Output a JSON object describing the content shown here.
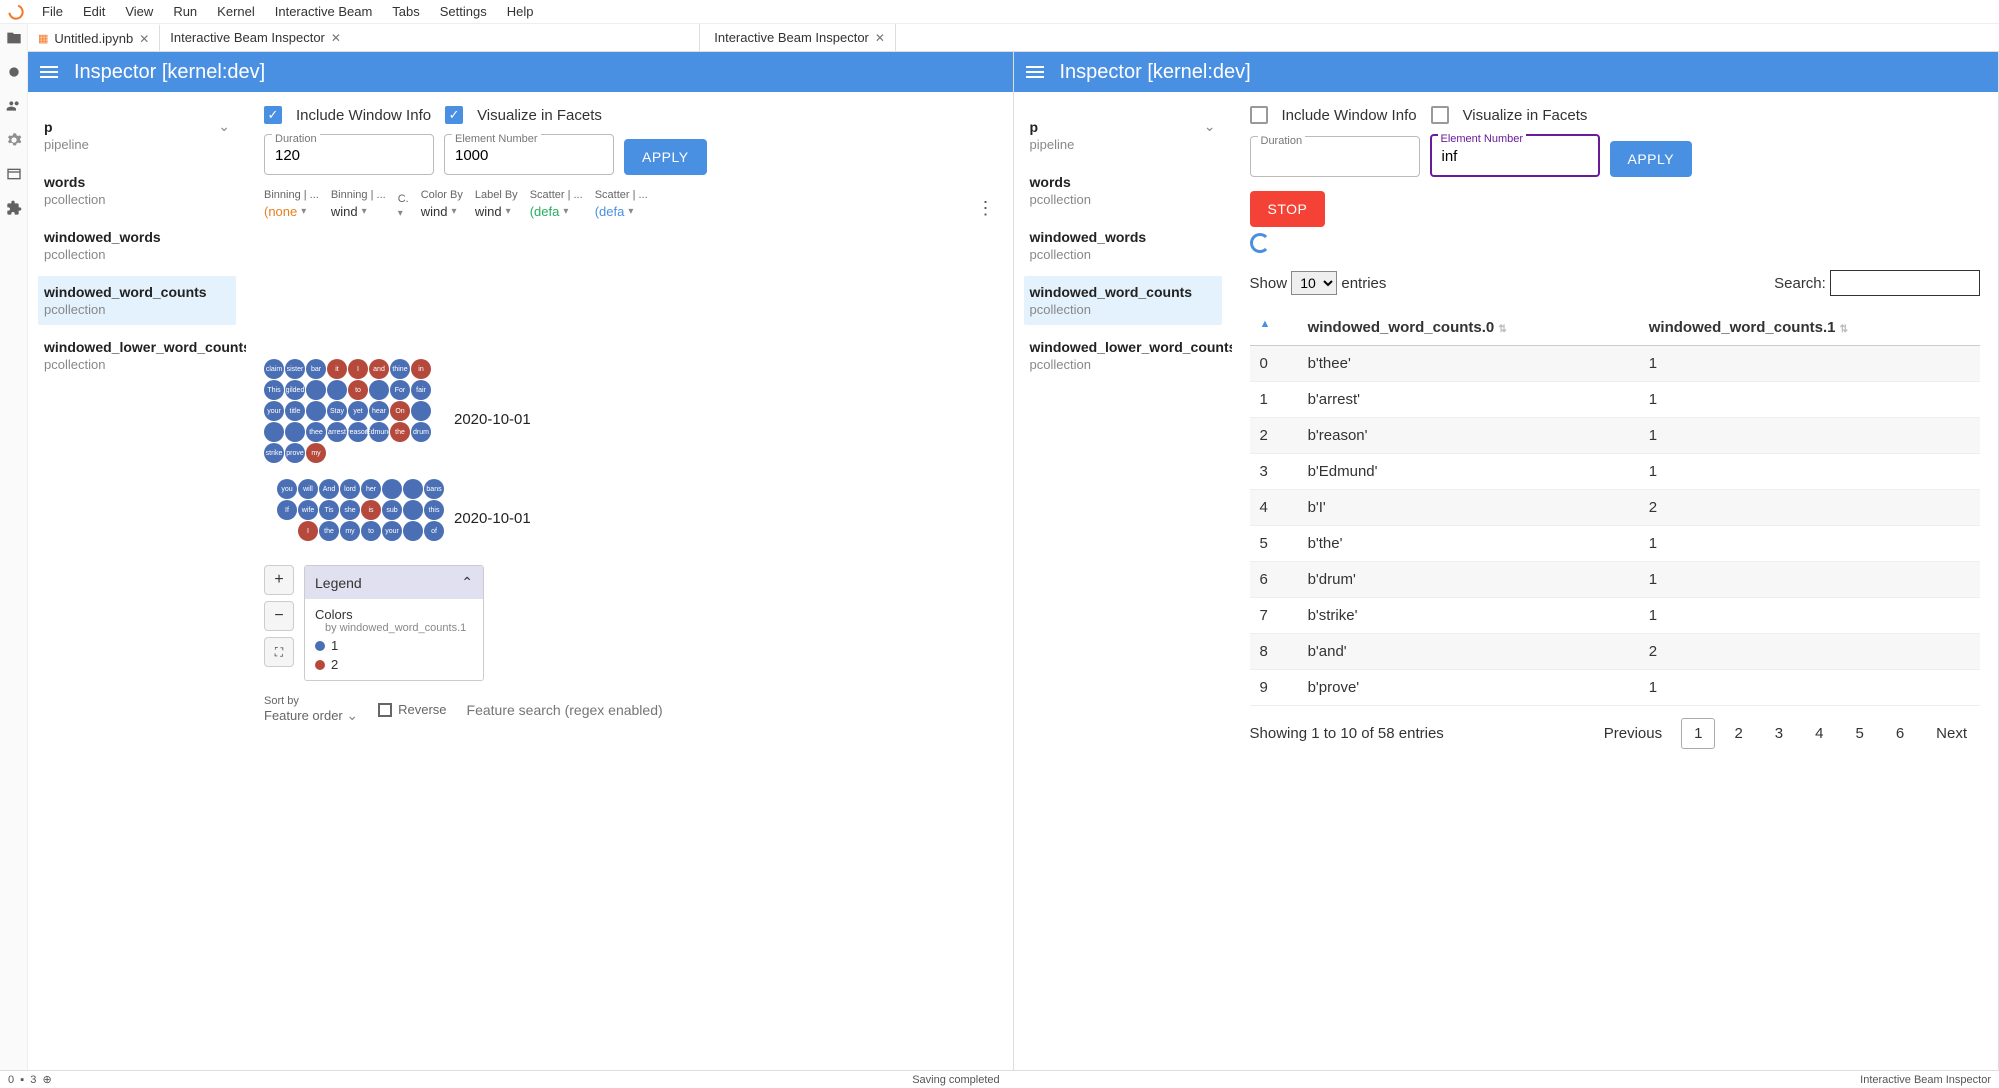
{
  "menubar": [
    "File",
    "Edit",
    "View",
    "Run",
    "Kernel",
    "Interactive Beam",
    "Tabs",
    "Settings",
    "Help"
  ],
  "tabs": {
    "notebook": "Untitled.ipynb",
    "inspector_a": "Interactive Beam Inspector",
    "inspector_b": "Interactive Beam Inspector"
  },
  "inspector": {
    "title": "Inspector [kernel:dev]"
  },
  "sidebar": {
    "p": {
      "name": "p",
      "type": "pipeline"
    },
    "items": [
      {
        "name": "words",
        "type": "pcollection"
      },
      {
        "name": "windowed_words",
        "type": "pcollection"
      },
      {
        "name": "windowed_word_counts",
        "type": "pcollection"
      },
      {
        "name": "windowed_lower_word_counts",
        "type": "pcollection"
      }
    ]
  },
  "left": {
    "include_window": "Include Window Info",
    "visualize_facets": "Visualize in Facets",
    "duration_label": "Duration",
    "duration_value": "120",
    "element_label": "Element Number",
    "element_value": "1000",
    "apply": "APPLY",
    "facets": [
      {
        "label": "Binning | ...",
        "val": "(none",
        "cls": "orange"
      },
      {
        "label": "Binning | ...",
        "val": "wind"
      },
      {
        "label": "C.",
        "val": ""
      },
      {
        "label": "Color By",
        "val": "wind"
      },
      {
        "label": "Label By",
        "val": "wind"
      },
      {
        "label": "Scatter | ...",
        "val": "(defa",
        "cls": "green"
      },
      {
        "label": "Scatter | ...",
        "val": "(defa",
        "cls": "blue"
      }
    ],
    "date1": "2020-10-01",
    "date2": "2020-10-01",
    "bubbles1": [
      {
        "t": "claim",
        "c": 1
      },
      {
        "t": "sister",
        "c": 1
      },
      {
        "t": "bar",
        "c": 1
      },
      {
        "t": "it",
        "c": 2
      },
      {
        "t": "I",
        "c": 2
      },
      {
        "t": "and",
        "c": 2
      },
      {
        "t": "thine",
        "c": 1
      },
      {
        "t": "in",
        "c": 2
      },
      {
        "t": "This",
        "c": 1
      },
      {
        "t": "gilded",
        "c": 1
      },
      {
        "t": "",
        "c": 1
      },
      {
        "t": "",
        "c": 1
      },
      {
        "t": "to",
        "c": 2
      },
      {
        "t": "",
        "c": 1
      },
      {
        "t": "For",
        "c": 1
      },
      {
        "t": "fair",
        "c": 1
      },
      {
        "t": "your",
        "c": 1
      },
      {
        "t": "title",
        "c": 1
      },
      {
        "t": "",
        "c": 1
      },
      {
        "t": "Stay",
        "c": 1
      },
      {
        "t": "yet",
        "c": 1
      },
      {
        "t": "hear",
        "c": 1
      },
      {
        "t": "On",
        "c": 2
      },
      {
        "t": "",
        "c": 1
      },
      {
        "t": "",
        "c": 1
      },
      {
        "t": "",
        "c": 1
      },
      {
        "t": "thee",
        "c": 1
      },
      {
        "t": "arrest",
        "c": 1
      },
      {
        "t": "reason",
        "c": 1
      },
      {
        "t": "Edmund",
        "c": 1
      },
      {
        "t": "the",
        "c": 2
      },
      {
        "t": "drum",
        "c": 1
      },
      {
        "t": "strike",
        "c": 1
      },
      {
        "t": "prove",
        "c": 1
      },
      {
        "t": "my",
        "c": 2
      }
    ],
    "bubbles2": [
      {
        "t": "you",
        "c": 1
      },
      {
        "t": "will",
        "c": 1
      },
      {
        "t": "And",
        "c": 1
      },
      {
        "t": "lord",
        "c": 1
      },
      {
        "t": "her",
        "c": 1
      },
      {
        "t": "",
        "c": 1
      },
      {
        "t": "",
        "c": 1
      },
      {
        "t": "bans",
        "c": 1
      },
      {
        "t": "If",
        "c": 1
      },
      {
        "t": "wife",
        "c": 1
      },
      {
        "t": "Tis",
        "c": 1
      },
      {
        "t": "she",
        "c": 1
      },
      {
        "t": "is",
        "c": 2
      },
      {
        "t": "sub",
        "c": 1
      },
      {
        "t": "",
        "c": 1
      },
      {
        "t": "this",
        "c": 1
      },
      {
        "t": "I",
        "c": 2
      },
      {
        "t": "the",
        "c": 1
      },
      {
        "t": "my",
        "c": 1
      },
      {
        "t": "to",
        "c": 1
      },
      {
        "t": "your",
        "c": 1
      },
      {
        "t": "",
        "c": 1
      },
      {
        "t": "of",
        "c": 1
      }
    ],
    "legend": {
      "title": "Legend",
      "colors_label": "Colors",
      "colors_by": "by windowed_word_counts.1",
      "items": [
        "1",
        "2"
      ]
    },
    "sortby_label": "Sort by",
    "sortby_value": "Feature order",
    "reverse": "Reverse",
    "feature_search": "Feature search (regex enabled)"
  },
  "right": {
    "include_window": "Include Window Info",
    "visualize_facets": "Visualize in Facets",
    "duration_label": "Duration",
    "element_label": "Element Number",
    "element_value": "inf",
    "apply": "APPLY",
    "stop": "STOP",
    "show": "Show",
    "show_count": "10",
    "entries": "entries",
    "search": "Search:",
    "col0": "windowed_word_counts.0",
    "col1": "windowed_word_counts.1",
    "rows": [
      {
        "i": "0",
        "w": "b'thee'",
        "c": "1"
      },
      {
        "i": "1",
        "w": "b'arrest'",
        "c": "1"
      },
      {
        "i": "2",
        "w": "b'reason'",
        "c": "1"
      },
      {
        "i": "3",
        "w": "b'Edmund'",
        "c": "1"
      },
      {
        "i": "4",
        "w": "b'I'",
        "c": "2"
      },
      {
        "i": "5",
        "w": "b'the'",
        "c": "1"
      },
      {
        "i": "6",
        "w": "b'drum'",
        "c": "1"
      },
      {
        "i": "7",
        "w": "b'strike'",
        "c": "1"
      },
      {
        "i": "8",
        "w": "b'and'",
        "c": "2"
      },
      {
        "i": "9",
        "w": "b'prove'",
        "c": "1"
      }
    ],
    "showing": "Showing 1 to 10 of 58 entries",
    "prev": "Previous",
    "next": "Next",
    "pages": [
      "1",
      "2",
      "3",
      "4",
      "5",
      "6"
    ]
  },
  "status": {
    "left_kernels": "3",
    "center": "Saving completed",
    "right": "Interactive Beam Inspector"
  }
}
